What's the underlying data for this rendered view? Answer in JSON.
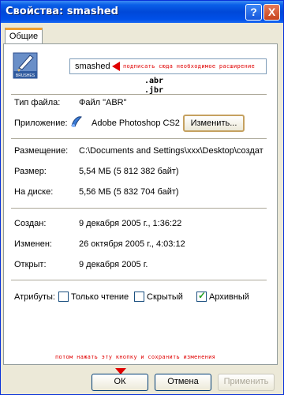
{
  "window": {
    "title": "Свойства: smashed",
    "help_btn": "?",
    "close_btn": "X"
  },
  "tabs": [
    {
      "label": "Общие"
    }
  ],
  "icon": {
    "caption": "BRUSHES"
  },
  "file": {
    "name_value": "smashed",
    "note_extension": "подписать сюда необходимое расширение",
    "ext_hint_1": ".abr",
    "ext_hint_2": ".jbr"
  },
  "props": {
    "type_label": "Тип файла:",
    "type_value": "Файл \"ABR\"",
    "app_label": "Приложение:",
    "app_value": "Adobe Photoshop CS2",
    "change_button": "Изменить...",
    "location_label": "Размещение:",
    "location_value": "C:\\Documents and Settings\\xxx\\Desktop\\создат",
    "size_label": "Размер:",
    "size_value": "5,54 МБ (5 812 382 байт)",
    "disk_label": "На диске:",
    "disk_value": "5,56 МБ (5 832 704 байт)",
    "created_label": "Создан:",
    "created_value": "9 декабря 2005 г., 1:36:22",
    "modified_label": "Изменен:",
    "modified_value": "26 октября 2005 г., 4:03:12",
    "opened_label": "Открыт:",
    "opened_value": "9 декабря 2005 г.",
    "attributes_label": "Атрибуты:",
    "attr_readonly": "Только чтение",
    "attr_hidden": "Скрытый",
    "attr_archive": "Архивный"
  },
  "checks": {
    "readonly": false,
    "hidden": false,
    "archive": true
  },
  "note_bottom": "потом нажать эту кнопку и сохранить изменения",
  "buttons": {
    "ok": "ОК",
    "cancel": "Отмена",
    "apply": "Применить"
  },
  "colors": {
    "annotation": "#e00000",
    "titlebar": "#0048d8"
  }
}
